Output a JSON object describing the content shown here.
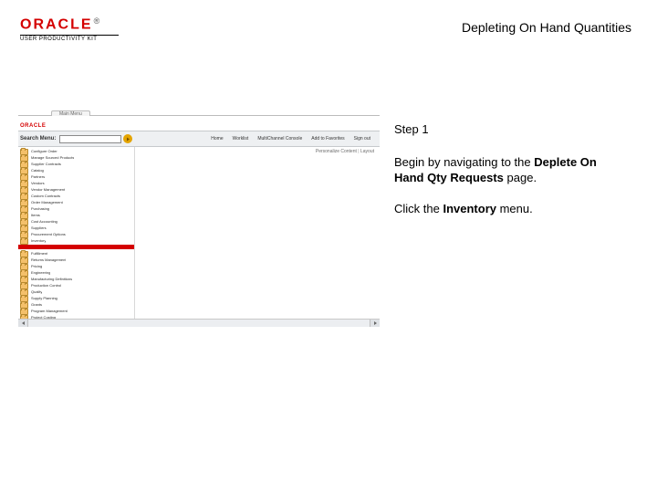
{
  "header": {
    "logo_wordmark": "ORACLE",
    "logo_trademark": "®",
    "logo_subtitle": "USER PRODUCTIVITY KIT",
    "title": "Depleting On Hand Quantities"
  },
  "instructions": {
    "step_label": "Step 1",
    "line1_prefix": "Begin by navigating to the ",
    "line1_bold": "Deplete On Hand Qty Requests",
    "line1_suffix": " page.",
    "line2_prefix": "Click the ",
    "line2_bold": "Inventory",
    "line2_suffix": " menu."
  },
  "screenshot": {
    "browser_tab": "Main Menu",
    "brand": "ORACLE",
    "toolbar": {
      "search_label": "Search Menu:",
      "links": [
        "Home",
        "Worklist",
        "MultiChannel Console",
        "Add to Favorites",
        "Sign out"
      ]
    },
    "personalize": {
      "label": "Personalize Content",
      "layout": "Layout"
    },
    "menu_groups": {
      "top": [
        "Configure Order",
        "Manage Sourced Products",
        "Supplier Contracts",
        "Catalog",
        "Partners",
        "Vendors",
        "Vendor Management",
        "Custom Contracts",
        "Order Management",
        "Purchasing",
        "Items",
        "Cost Accounting",
        "Suppliers",
        "Procurement Options",
        "Inventory"
      ],
      "bottom": [
        "Fulfillment",
        "Returns Management",
        "Pricing",
        "Engineering",
        "Manufacturing Definitions",
        "Production Control",
        "Quality",
        "Supply Planning",
        "Grants",
        "Program Management",
        "Project Costing"
      ]
    }
  }
}
